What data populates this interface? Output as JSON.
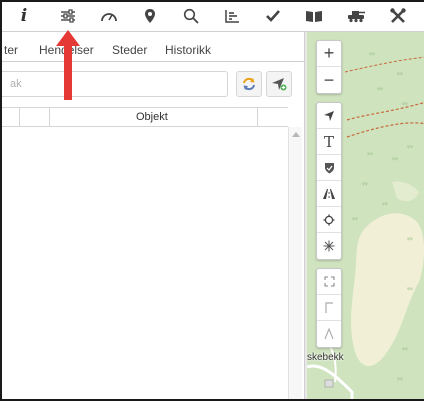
{
  "toolbar": {
    "items": [
      {
        "icon": "info-icon",
        "label": "i"
      },
      {
        "icon": "sliders-icon"
      },
      {
        "icon": "gauge-icon"
      },
      {
        "icon": "map-pin-icon"
      },
      {
        "icon": "search-icon"
      },
      {
        "icon": "chart-icon"
      },
      {
        "icon": "check-icon"
      },
      {
        "icon": "book-icon"
      },
      {
        "icon": "tank-icon"
      },
      {
        "icon": "tools-icon"
      }
    ]
  },
  "tabs": [
    {
      "label": "ter"
    },
    {
      "label": "Hendelser"
    },
    {
      "label": "Steder"
    },
    {
      "label": "Historikk"
    }
  ],
  "search": {
    "placeholder": "ak"
  },
  "table": {
    "columns": [
      "Objekt"
    ]
  },
  "map": {
    "place_label": "skebekk",
    "zoom_in": "+",
    "zoom_out": "−",
    "text_tool": "T",
    "colors": {
      "forest": "#cfe3bf",
      "clearing": "#f1f0d6",
      "trail": "#c86a3a"
    }
  },
  "annotation": {
    "color": "#e53935"
  }
}
